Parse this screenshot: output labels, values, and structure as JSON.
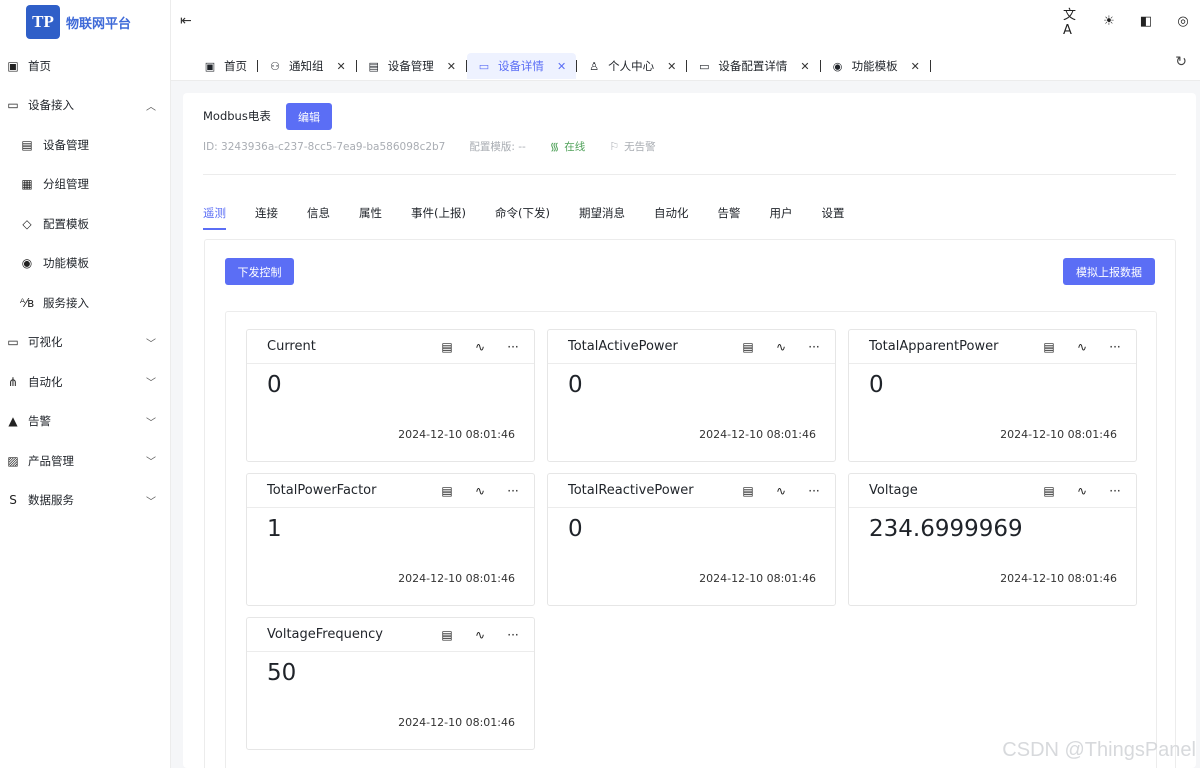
{
  "app": {
    "logo_letter": "TP",
    "name": "物联网平台"
  },
  "sidebar": {
    "items": [
      {
        "label": "首页",
        "icon": "home-icon",
        "glyph": "▣",
        "sub": false,
        "chevron": ""
      },
      {
        "label": "设备接入",
        "icon": "monitor-icon",
        "glyph": "▭",
        "sub": false,
        "chevron": "︿"
      },
      {
        "label": "设备管理",
        "icon": "device-icon",
        "glyph": "▤",
        "sub": true,
        "chevron": ""
      },
      {
        "label": "分组管理",
        "icon": "grid-icon",
        "glyph": "▦",
        "sub": true,
        "chevron": ""
      },
      {
        "label": "配置模板",
        "icon": "puzzle-icon",
        "glyph": "◇",
        "sub": true,
        "chevron": ""
      },
      {
        "label": "功能模板",
        "icon": "circle-icon",
        "glyph": "◉",
        "sub": true,
        "chevron": ""
      },
      {
        "label": "服务接入",
        "icon": "ab-icon",
        "glyph": "ᴬ⁄ʙ",
        "sub": true,
        "chevron": ""
      },
      {
        "label": "可视化",
        "icon": "screen-icon",
        "glyph": "▭",
        "sub": false,
        "chevron": "﹀"
      },
      {
        "label": "自动化",
        "icon": "network-icon",
        "glyph": "⋔",
        "sub": false,
        "chevron": "﹀"
      },
      {
        "label": "告警",
        "icon": "warning-icon",
        "glyph": "▲",
        "sub": false,
        "chevron": "﹀"
      },
      {
        "label": "产品管理",
        "icon": "product-icon",
        "glyph": "▨",
        "sub": false,
        "chevron": "﹀"
      },
      {
        "label": "数据服务",
        "icon": "data-service-icon",
        "glyph": "S",
        "sub": false,
        "chevron": "﹀"
      }
    ]
  },
  "topbar": {
    "collapse_glyph": "⇤",
    "actions": [
      {
        "name": "translate-icon",
        "glyph": "文A"
      },
      {
        "name": "sun-icon",
        "glyph": "☀"
      },
      {
        "name": "theme-icon",
        "glyph": "◧"
      },
      {
        "name": "user-icon",
        "glyph": "◎"
      }
    ],
    "refresh_glyph": "↻"
  },
  "tabs": [
    {
      "label": "首页",
      "icon": "home-icon",
      "glyph": "▣",
      "closable": false,
      "active": false
    },
    {
      "label": "通知组",
      "icon": "group-icon",
      "glyph": "⚇",
      "closable": true,
      "active": false
    },
    {
      "label": "设备管理",
      "icon": "device-icon",
      "glyph": "▤",
      "closable": true,
      "active": false
    },
    {
      "label": "设备详情",
      "icon": "monitor-icon",
      "glyph": "▭",
      "closable": true,
      "active": true
    },
    {
      "label": "个人中心",
      "icon": "person-icon",
      "glyph": "♙",
      "closable": true,
      "active": false
    },
    {
      "label": "设备配置详情",
      "icon": "screen-icon",
      "glyph": "▭",
      "closable": true,
      "active": false
    },
    {
      "label": "功能模板",
      "icon": "circle-icon",
      "glyph": "◉",
      "closable": true,
      "active": false
    }
  ],
  "device": {
    "name": "Modbus电表",
    "edit_label": "编辑",
    "id_text": "ID: 3243936a-c237-8cc5-7ea9-ba586098c2b7",
    "config_text": "配置模版: --",
    "online_label": "在线",
    "alarm_label": "无告警"
  },
  "subtabs": [
    "遥测",
    "连接",
    "信息",
    "属性",
    "事件(上报)",
    "命令(下发)",
    "期望消息",
    "自动化",
    "告警",
    "用户",
    "设置"
  ],
  "actions": {
    "send_control": "下发控制",
    "simulate_report": "模拟上报数据"
  },
  "telemetry": [
    {
      "name": "Current",
      "value": "0",
      "time": "2024-12-10 08:01:46"
    },
    {
      "name": "TotalActivePower",
      "value": "0",
      "time": "2024-12-10 08:01:46"
    },
    {
      "name": "TotalApparentPower",
      "value": "0",
      "time": "2024-12-10 08:01:46"
    },
    {
      "name": "TotalPowerFactor",
      "value": "1",
      "time": "2024-12-10 08:01:46"
    },
    {
      "name": "TotalReactivePower",
      "value": "0",
      "time": "2024-12-10 08:01:46"
    },
    {
      "name": "Voltage",
      "value": "234.6999969",
      "time": "2024-12-10 08:01:46"
    },
    {
      "name": "VoltageFrequency",
      "value": "50",
      "time": "2024-12-10 08:01:46"
    }
  ],
  "card_tools": {
    "doc_glyph": "▤",
    "chart_glyph": "∿",
    "more_glyph": "···"
  },
  "watermark": "CSDN @ThingsPanel",
  "colors": {
    "primary": "#5b6ef5",
    "online": "#52a35c",
    "logo": "#2f5fc8"
  }
}
